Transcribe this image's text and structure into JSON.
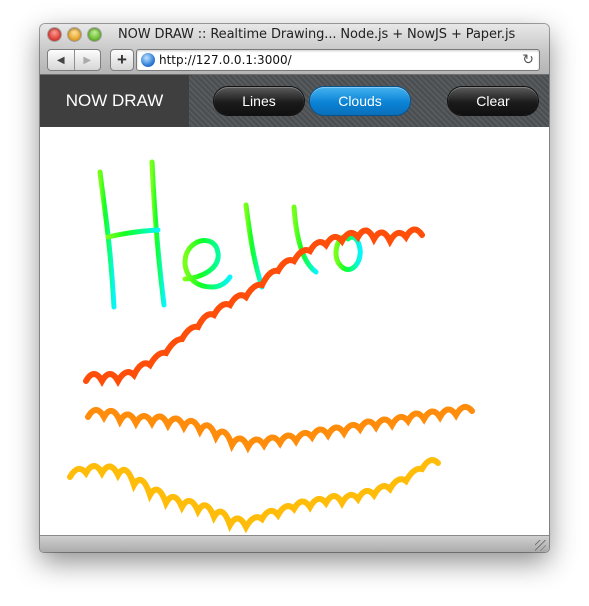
{
  "window": {
    "title": "NOW DRAW :: Realtime Drawing... Node.js + NowJS + Paper.js"
  },
  "toolbar": {
    "back_icon": "◀",
    "forward_icon": "▶",
    "add_icon": "+",
    "url": "http://127.0.0.1:3000/",
    "reload_icon": "↻"
  },
  "app": {
    "brand": "NOW DRAW",
    "buttons": {
      "lines": "Lines",
      "clouds": "Clouds",
      "clear": "Clear"
    },
    "active_mode": "Clouds"
  },
  "drawing": {
    "strokes": [
      {
        "name": "hello-text",
        "colors": [
          "#7bff1a",
          "#12ff22",
          "#08ff8f",
          "#08f4ff"
        ]
      },
      {
        "name": "cloud-stroke-red",
        "color": "#ff4d0a"
      },
      {
        "name": "cloud-stroke-orange",
        "color": "#ff8c0a"
      },
      {
        "name": "cloud-stroke-yellow",
        "color": "#ffbd0a"
      }
    ]
  },
  "colors": {
    "accent": "#0b83d6",
    "appbar": "#555a5e",
    "brand_bg": "#3f3f3f"
  }
}
